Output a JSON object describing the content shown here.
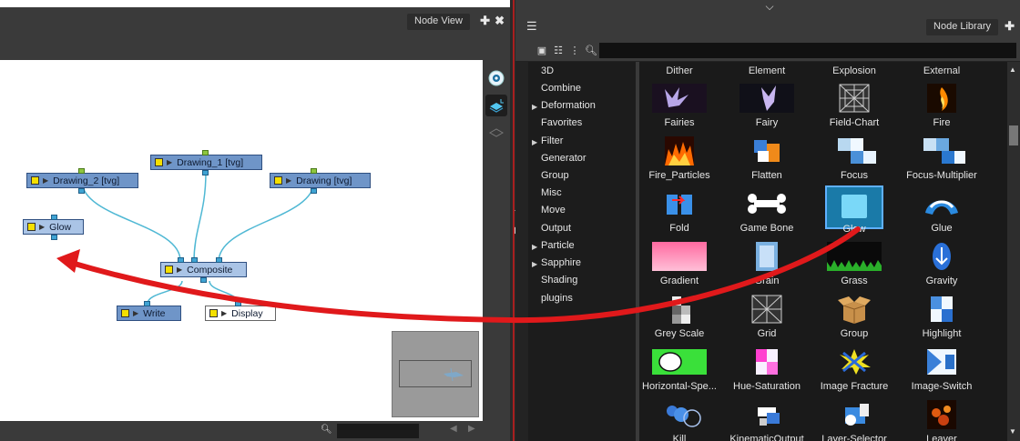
{
  "node_view": {
    "title": "Node View",
    "nodes": {
      "drawing_1": "Drawing_1 [tvg]",
      "drawing_2": "Drawing_2 [tvg]",
      "drawing": "Drawing [tvg]",
      "glow": "Glow",
      "composite": "Composite",
      "write": "Write",
      "display": "Display"
    }
  },
  "node_library": {
    "title": "Node Library",
    "categories": [
      "3D",
      "Combine",
      "Deformation",
      "Favorites",
      "Filter",
      "Generator",
      "Group",
      "Misc",
      "Move",
      "Output",
      "Particle",
      "Sapphire",
      "Shading",
      "plugins"
    ],
    "column_headers": [
      "Dither",
      "Element",
      "Explosion",
      "External"
    ],
    "rows": [
      [
        "Fairies",
        "Fairy",
        "Field-Chart",
        "Fire"
      ],
      [
        "Fire_Particles",
        "Flatten",
        "Focus",
        "Focus-Multiplier"
      ],
      [
        "Fold",
        "Game Bone",
        "Glow",
        "Glue"
      ],
      [
        "Gradient",
        "Grain",
        "Grass",
        "Gravity"
      ],
      [
        "Grey Scale",
        "Grid",
        "Group",
        "Highlight"
      ],
      [
        "Horizontal-Spe...",
        "Hue-Saturation",
        "Image Fracture",
        "Image-Switch"
      ],
      [
        "Kill",
        "KinematicOutput",
        "Layer-Selector",
        "Leaver"
      ]
    ],
    "selected": "Glow"
  },
  "colors": {
    "node_blue": "#6f95c8",
    "port_blue": "#3fa3d3",
    "arrow_red": "#e0191b",
    "panel_dark": "#232323"
  }
}
